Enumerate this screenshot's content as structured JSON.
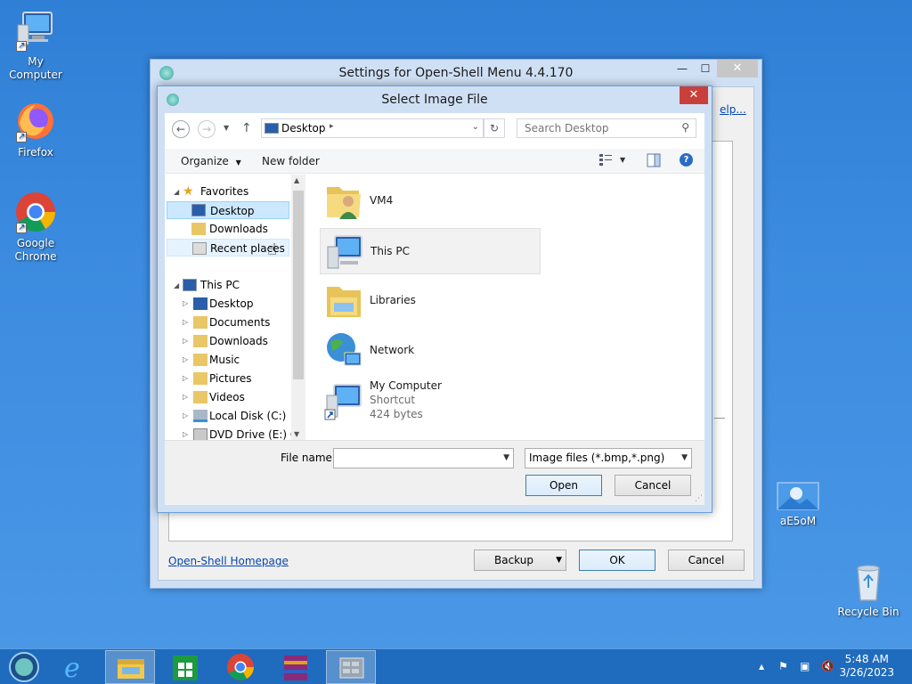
{
  "desktop": {
    "icons": [
      {
        "label": "My Computer"
      },
      {
        "label": "Firefox"
      },
      {
        "label": "Google Chrome"
      },
      {
        "label": "aE5oM"
      },
      {
        "label": "Recycle Bin"
      }
    ]
  },
  "settings_window": {
    "title": "Settings for Open-Shell Menu 4.4.170",
    "help_link": "elp...",
    "homepage_link": "Open-Shell Homepage",
    "backup_label": "Backup",
    "ok_label": "OK",
    "cancel_label": "Cancel",
    "minimize": "—",
    "maximize": "☐",
    "close": "✕"
  },
  "dialog": {
    "title": "Select Image File",
    "close": "✕",
    "address": {
      "location": "Desktop"
    },
    "search": {
      "placeholder": "Search Desktop"
    },
    "toolbar": {
      "organize": "Organize",
      "new_folder": "New folder"
    },
    "nav": {
      "favorites_header": "Favorites",
      "favorites": [
        {
          "label": "Desktop"
        },
        {
          "label": "Downloads"
        },
        {
          "label": "Recent places"
        }
      ],
      "this_pc_header": "This PC",
      "this_pc": [
        {
          "label": "Desktop"
        },
        {
          "label": "Documents"
        },
        {
          "label": "Downloads"
        },
        {
          "label": "Music"
        },
        {
          "label": "Pictures"
        },
        {
          "label": "Videos"
        },
        {
          "label": "Local Disk (C:)"
        },
        {
          "label": "DVD Drive (E:) CP"
        }
      ]
    },
    "files": [
      {
        "name": "VM4"
      },
      {
        "name": "This PC"
      },
      {
        "name": "Libraries"
      },
      {
        "name": "Network"
      },
      {
        "name": "My Computer",
        "type": "Shortcut",
        "size": "424 bytes"
      }
    ],
    "file_name_label": "File name:",
    "file_name_value": "",
    "file_type": "Image files (*.bmp,*.png)",
    "open_label": "Open",
    "cancel_label": "Cancel"
  },
  "taskbar": {
    "time": "5:48 AM",
    "date": "3/26/2023"
  },
  "colors": {
    "desktop_bg": "#3b8be0",
    "taskbar_bg": "#1f6bbd",
    "close_red": "#c9403a",
    "selection": "#cce8ff"
  }
}
